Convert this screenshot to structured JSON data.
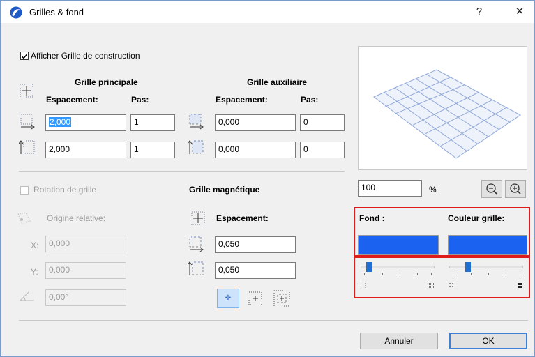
{
  "window": {
    "title": "Grilles & fond",
    "help_label": "?",
    "close_label": "✕"
  },
  "construction": {
    "show_grid_label": "Afficher Grille de construction",
    "show_grid_checked": true
  },
  "main_grid": {
    "title": "Grille principale",
    "spacing_header": "Espacement:",
    "step_header": "Pas:",
    "horizontal_spacing": "2,000",
    "horizontal_step": "1",
    "vertical_spacing": "2,000",
    "vertical_step": "1"
  },
  "aux_grid": {
    "title": "Grille auxiliaire",
    "spacing_header": "Espacement:",
    "step_header": "Pas:",
    "horizontal_spacing": "0,000",
    "horizontal_step": "0",
    "vertical_spacing": "0,000",
    "vertical_step": "0"
  },
  "rotation": {
    "label": "Rotation de grille",
    "checked": false,
    "origin_label": "Origine relative:",
    "x_label": "X:",
    "x_value": "0,000",
    "y_label": "Y:",
    "y_value": "0,000",
    "angle_value": "0,00°"
  },
  "snap_grid": {
    "title": "Grille magnétique",
    "spacing_header": "Espacement:",
    "horizontal_spacing": "0,050",
    "vertical_spacing": "0,050"
  },
  "preview": {
    "zoom_value": "100",
    "zoom_unit": "%"
  },
  "colors": {
    "background_label": "Fond :",
    "grid_color_label": "Couleur grille:",
    "background_color": "#1c62f0",
    "grid_color": "#1c62f0",
    "background_density_fraction": 0.08,
    "grid_density_fraction": 0.23
  },
  "footer": {
    "cancel_label": "Annuler",
    "ok_label": "OK"
  }
}
